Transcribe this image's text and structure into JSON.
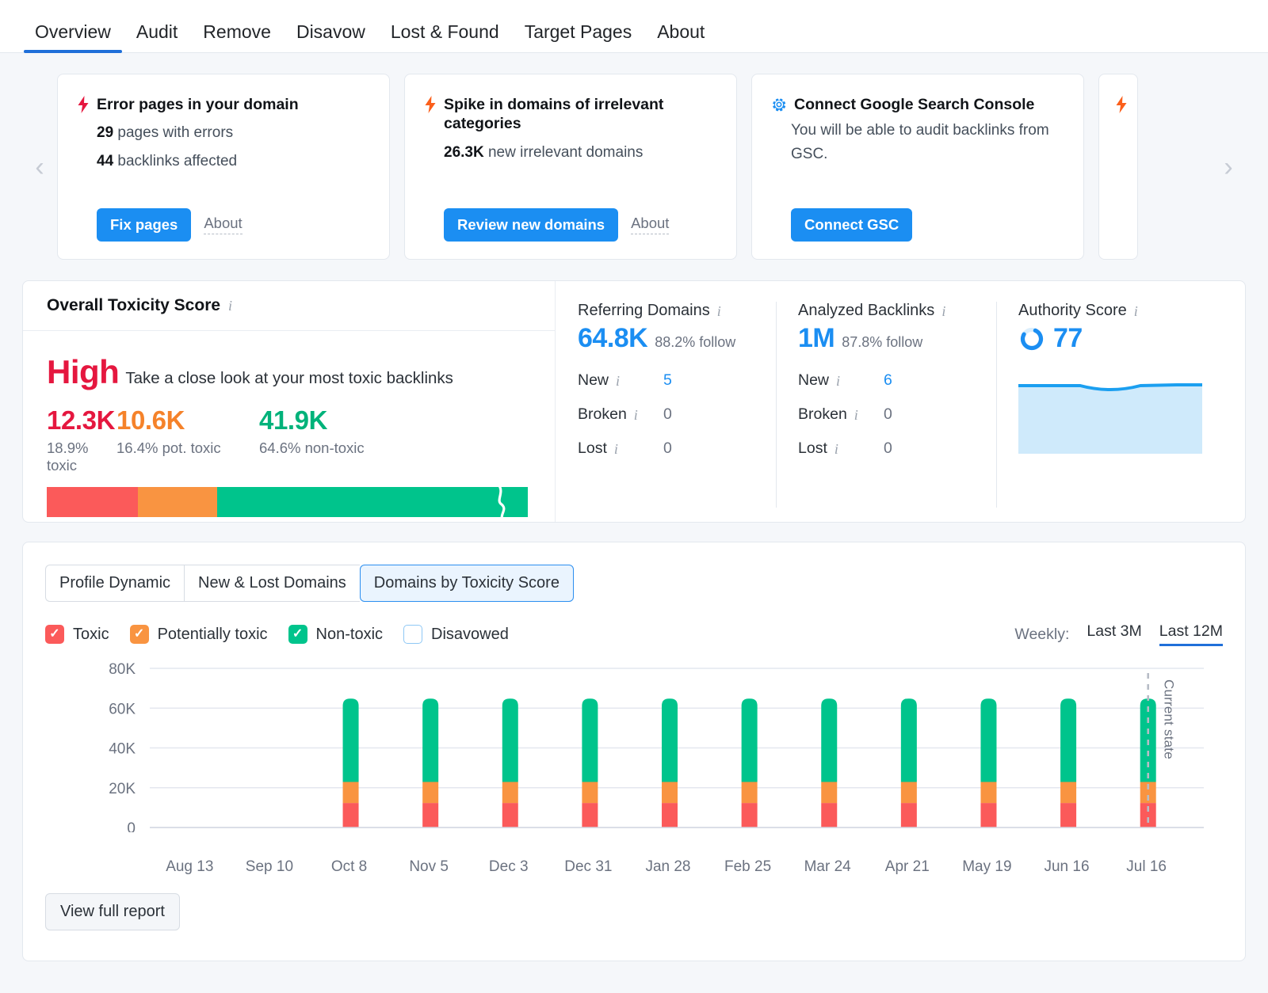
{
  "nav": {
    "items": [
      {
        "label": "Overview",
        "active": true
      },
      {
        "label": "Audit",
        "active": false
      },
      {
        "label": "Remove",
        "active": false
      },
      {
        "label": "Disavow",
        "active": false
      },
      {
        "label": "Lost & Found",
        "active": false
      },
      {
        "label": "Target Pages",
        "active": false
      },
      {
        "label": "About",
        "active": false
      }
    ]
  },
  "carousel": {
    "prev_icon": "chevron-left-icon",
    "next_icon": "chevron-right-icon",
    "cards": [
      {
        "icon": "bolt-icon",
        "icon_color": "#e5173f",
        "title": "Error pages in your domain",
        "stat1_value": "29",
        "stat1_label": "pages with errors",
        "stat2_value": "44",
        "stat2_label": "backlinks affected",
        "primary_label": "Fix pages",
        "link_label": "About"
      },
      {
        "icon": "bolt-icon",
        "icon_color": "#fb5f1b",
        "title": "Spike in domains of irrelevant categories",
        "stat1_value": "26.3K",
        "stat1_label": "new irrelevant domains",
        "primary_label": "Review new domains",
        "link_label": "About"
      },
      {
        "icon": "gear-icon",
        "icon_color": "#1b8ef2",
        "title": "Connect Google Search Console",
        "description": "You will be able to audit backlinks from GSC.",
        "primary_label": "Connect GSC"
      }
    ]
  },
  "toxicity": {
    "title": "Overall Toxicity Score",
    "level": "High",
    "hint": "Take a close look at your most toxic backlinks",
    "metrics": [
      {
        "value": "12.3K",
        "label": "18.9% toxic",
        "color": "#e5173f",
        "pct": 18.9
      },
      {
        "value": "10.6K",
        "label": "16.4% pot. toxic",
        "color": "#f5822a",
        "pct": 16.4
      },
      {
        "value": "41.9K",
        "label": "64.6% non-toxic",
        "color": "#00b27a",
        "pct": 64.6
      }
    ]
  },
  "metrics_panel": {
    "referring_domains": {
      "title": "Referring Domains",
      "value": "64.8K",
      "follow": "88.2% follow",
      "rows": [
        {
          "label": "New",
          "value": "5",
          "accent": true
        },
        {
          "label": "Broken",
          "value": "0",
          "accent": false
        },
        {
          "label": "Lost",
          "value": "0",
          "accent": false
        }
      ]
    },
    "analyzed_backlinks": {
      "title": "Analyzed Backlinks",
      "value": "1M",
      "follow": "87.8% follow",
      "rows": [
        {
          "label": "New",
          "value": "6",
          "accent": true
        },
        {
          "label": "Broken",
          "value": "0",
          "accent": false
        },
        {
          "label": "Lost",
          "value": "0",
          "accent": false
        }
      ]
    },
    "authority_score": {
      "title": "Authority Score",
      "value": "77"
    }
  },
  "chart_section": {
    "tabs": [
      {
        "label": "Profile Dynamic",
        "active": false
      },
      {
        "label": "New & Lost Domains",
        "active": false
      },
      {
        "label": "Domains by Toxicity Score",
        "active": true
      }
    ],
    "legend": [
      {
        "label": "Toxic",
        "color": "#fb5a5a",
        "checked": true
      },
      {
        "label": "Potentially toxic",
        "color": "#f99441",
        "checked": true
      },
      {
        "label": "Non-toxic",
        "color": "#00c48c",
        "checked": true
      },
      {
        "label": "Disavowed",
        "color": "#ffffff",
        "checked": false
      }
    ],
    "range_label": "Weekly:",
    "range_options": [
      {
        "label": "Last 3M",
        "active": false
      },
      {
        "label": "Last 12M",
        "active": true
      }
    ],
    "current_state_label": "Current state",
    "view_report_label": "View full report"
  },
  "chart_data": {
    "type": "bar",
    "stacked": true,
    "title": "Domains by Toxicity Score",
    "xlabel": "",
    "ylabel": "",
    "ylim": [
      0,
      80000
    ],
    "yticks": [
      "0",
      "20K",
      "40K",
      "60K",
      "80K"
    ],
    "ytick_values": [
      0,
      20000,
      40000,
      60000,
      80000
    ],
    "grid": true,
    "legend_position": "top-left",
    "categories": [
      "Aug 13",
      "Sep 10",
      "Oct 8",
      "Nov 5",
      "Dec 3",
      "Dec 31",
      "Jan 28",
      "Feb 25",
      "Mar 24",
      "Apr 21",
      "May 19",
      "Jun 16",
      "Jul 16"
    ],
    "bar_count": 11,
    "bars": [
      {
        "index": 0,
        "toxic": 12300,
        "potentially_toxic": 10600,
        "non_toxic": 41900
      },
      {
        "index": 1,
        "toxic": 12300,
        "potentially_toxic": 10600,
        "non_toxic": 41900
      },
      {
        "index": 2,
        "toxic": 12300,
        "potentially_toxic": 10600,
        "non_toxic": 41900
      },
      {
        "index": 3,
        "toxic": 12300,
        "potentially_toxic": 10600,
        "non_toxic": 41900
      },
      {
        "index": 4,
        "toxic": 12300,
        "potentially_toxic": 10600,
        "non_toxic": 41900
      },
      {
        "index": 5,
        "toxic": 12300,
        "potentially_toxic": 10600,
        "non_toxic": 41900
      },
      {
        "index": 6,
        "toxic": 12300,
        "potentially_toxic": 10600,
        "non_toxic": 41900
      },
      {
        "index": 7,
        "toxic": 12300,
        "potentially_toxic": 10600,
        "non_toxic": 41900
      },
      {
        "index": 8,
        "toxic": 12300,
        "potentially_toxic": 10600,
        "non_toxic": 41900
      },
      {
        "index": 9,
        "toxic": 12300,
        "potentially_toxic": 10600,
        "non_toxic": 41900
      },
      {
        "index": 10,
        "toxic": 12300,
        "potentially_toxic": 10600,
        "non_toxic": 41900
      }
    ],
    "series": [
      {
        "name": "Toxic",
        "color": "#fb5a5a"
      },
      {
        "name": "Potentially toxic",
        "color": "#f99441"
      },
      {
        "name": "Non-toxic",
        "color": "#00c48c"
      }
    ],
    "annotations": [
      {
        "type": "vline",
        "label": "Current state",
        "at_category": "Jul 16",
        "style": "dashed"
      }
    ]
  }
}
